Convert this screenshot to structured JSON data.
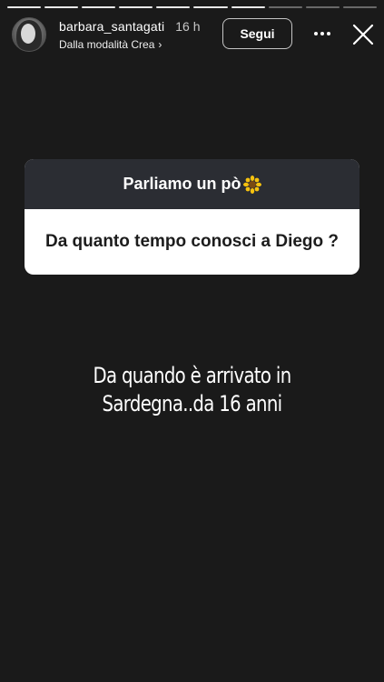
{
  "story": {
    "segments_total": 10,
    "segments_done": 7
  },
  "header": {
    "username": "barbara_santagati",
    "time": "16 h",
    "mode_label": "Dalla modalità Crea",
    "follow_label": "Segui",
    "avatar_icon": "profile-avatar",
    "more_icon": "more-horizontal-icon",
    "close_icon": "close-icon"
  },
  "question": {
    "prompt": "Parliamo un pò",
    "prompt_emoji": "sunflower-icon",
    "question_text": "Da quanto tempo conosci a Diego ?"
  },
  "answer": {
    "line1": "Da quando è arrivato in",
    "line2": "Sardegna..da 16 anni"
  },
  "colors": {
    "background": "#1a1a1a",
    "card_header": "#2b2d33",
    "card_body": "#ffffff"
  }
}
